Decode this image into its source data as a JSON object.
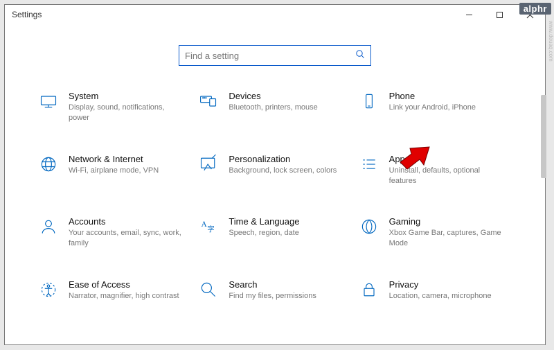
{
  "window": {
    "title": "Settings"
  },
  "search": {
    "placeholder": "Find a setting"
  },
  "tiles": [
    {
      "id": "system",
      "title": "System",
      "desc": "Display, sound, notifications, power"
    },
    {
      "id": "devices",
      "title": "Devices",
      "desc": "Bluetooth, printers, mouse"
    },
    {
      "id": "phone",
      "title": "Phone",
      "desc": "Link your Android, iPhone"
    },
    {
      "id": "network",
      "title": "Network & Internet",
      "desc": "Wi-Fi, airplane mode, VPN"
    },
    {
      "id": "personalization",
      "title": "Personalization",
      "desc": "Background, lock screen, colors"
    },
    {
      "id": "apps",
      "title": "Apps",
      "desc": "Uninstall, defaults, optional features"
    },
    {
      "id": "accounts",
      "title": "Accounts",
      "desc": "Your accounts, email, sync, work, family"
    },
    {
      "id": "time",
      "title": "Time & Language",
      "desc": "Speech, region, date"
    },
    {
      "id": "gaming",
      "title": "Gaming",
      "desc": "Xbox Game Bar, captures, Game Mode"
    },
    {
      "id": "ease",
      "title": "Ease of Access",
      "desc": "Narrator, magnifier, high contrast"
    },
    {
      "id": "search-tile",
      "title": "Search",
      "desc": "Find my files, permissions"
    },
    {
      "id": "privacy",
      "title": "Privacy",
      "desc": "Location, camera, microphone"
    }
  ],
  "watermark": "alphr",
  "sidetext": "www.deuaq.com",
  "colors": {
    "accent": "#0067c0",
    "search_border": "#0a5acb"
  }
}
